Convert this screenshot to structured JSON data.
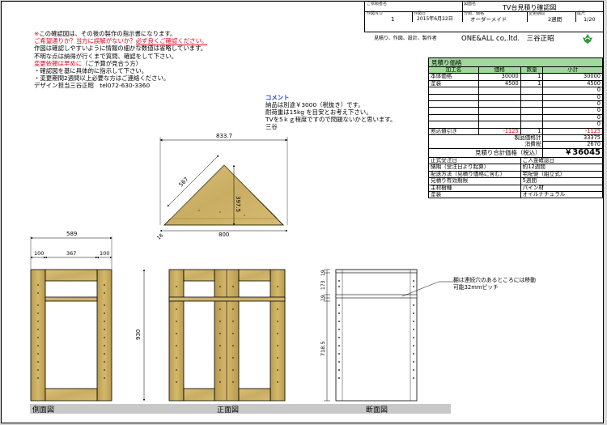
{
  "title_block": {
    "requester_label": "ご依頼者名",
    "drawing_name_label": "図面名",
    "drawing_name": "TV台見積り確認図",
    "drawing_no_label": "作図ＮＯ",
    "drawing_no": "1",
    "date_label": "作図日",
    "date": "2015年6月22日",
    "category_label": "分類、価格",
    "category": "オーダーメイド",
    "period_label": "変更期間",
    "period": "2週間",
    "page_label": "尾尺",
    "page": "1/20",
    "company_label": "見積り、作図、設計、製作者",
    "company": "ONE&ALL co,.ltd.　三谷正昭"
  },
  "notes": {
    "line1_mark": "※",
    "line1": "この確認図は、その後の製作の指示書になります。",
    "line2a": "ご希望通りか？当方に誤解がないか？",
    "line2b": "必ず良くご確認ください。",
    "line3": "作図は確認しやすいように情報の細かな数値は省略しています。",
    "line4": "不明な点は納得が行くまで質問、確認をして下さい。",
    "line5a": "変更依頼は早めに",
    "line5b": "（ご予算が見合う方）",
    "line6": "・確認図を基に具体的に指示して下さい。",
    "line7": "・変更期間2週間以上必要な方はご連絡ください。",
    "line8": "デザイン担当三谷正昭　tel072-630-3360"
  },
  "comment": {
    "title": "コメント",
    "line1": "納品は別途￥3000（税抜き）です。",
    "line2": "耐荷重は15kg を目安とお考え下さい。",
    "line3": "TVを5ｋｇ程度ですので問題ないかと思います。",
    "line4": "三谷"
  },
  "estimate": {
    "title": "見積り価格",
    "headers": [
      "加工名",
      "価格",
      "数量",
      "小計"
    ],
    "rows": [
      {
        "name": "本体価格",
        "price": "30000",
        "qty": "1",
        "subtotal": "30000"
      },
      {
        "name": "塗装",
        "price": "4500",
        "qty": "1",
        "subtotal": "4500"
      },
      {
        "name": "",
        "price": "",
        "qty": "",
        "subtotal": "0"
      },
      {
        "name": "",
        "price": "",
        "qty": "",
        "subtotal": "0"
      },
      {
        "name": "",
        "price": "",
        "qty": "",
        "subtotal": "0"
      },
      {
        "name": "",
        "price": "",
        "qty": "",
        "subtotal": "0"
      },
      {
        "name": "",
        "price": "",
        "qty": "",
        "subtotal": "0"
      },
      {
        "name": "",
        "price": "",
        "qty": "",
        "subtotal": "0"
      }
    ],
    "discount_label": "割込値引き",
    "discount_price": "-1125",
    "discount_qty": "1",
    "discount_subtotal": "-1125",
    "product_price_label": "製品価格計",
    "product_price": "33375",
    "tax_label": "消費税",
    "tax": "2670",
    "total_label": "見積り合計価格（税込）",
    "total": "￥36045",
    "info": [
      {
        "label": "正式受注日",
        "value": "ご入金確認日"
      },
      {
        "label": "納期（受注日より起算）",
        "value": "約12週間"
      },
      {
        "label": "配送方法（見積り価格に含む）",
        "value": "宅配便（組立式）"
      },
      {
        "label": "見積り有効期限",
        "value": "5週間"
      },
      {
        "label": "主材樹種",
        "value": "パイン材"
      },
      {
        "label": "塗装",
        "value": "オイルナチュラル"
      }
    ],
    "accent": "#e0001a",
    "head_color": "#9fd89a"
  },
  "dims": {
    "top_width": "833.7",
    "side": "567",
    "height": "397.5",
    "depth": "18",
    "base": "800",
    "side_total": "589",
    "side_left": "100",
    "side_mid": "367",
    "side_right": "100",
    "front_height": "930",
    "d1": "19",
    "d2": "173",
    "d3": "19",
    "d4": "173",
    "d5": "19",
    "d6": "718.5",
    "shelf_note1": "棚は連続穴のあるところには移動",
    "shelf_note2": "可能32mmピッチ"
  },
  "views": {
    "side": "側面図",
    "front": "正面図",
    "section": "断面図"
  }
}
